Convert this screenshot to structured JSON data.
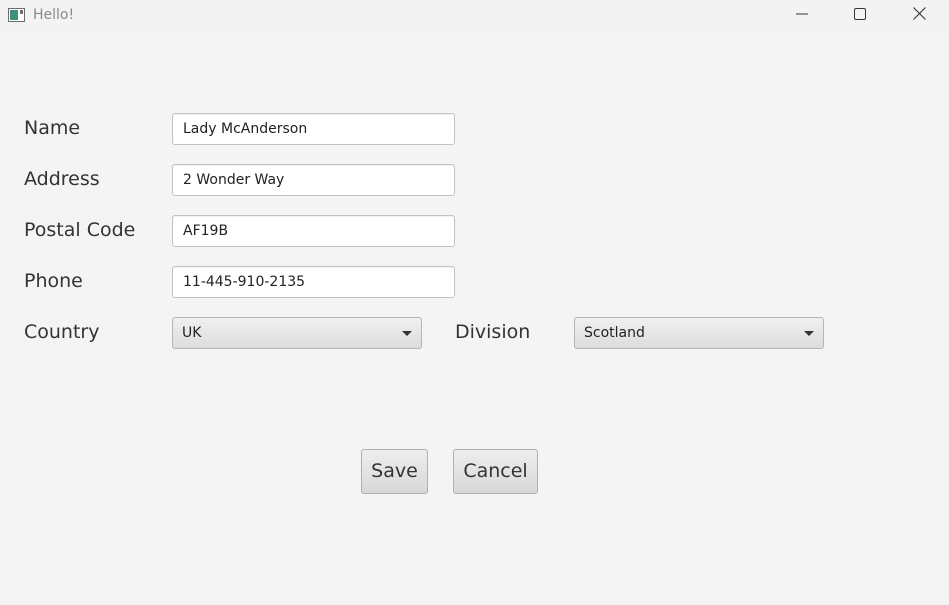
{
  "window": {
    "title": "Hello!",
    "icon": "app-window-icon",
    "controls": [
      "minimize-icon",
      "maximize-icon",
      "close-icon"
    ]
  },
  "form": {
    "name": {
      "label": "Name",
      "value": "Lady McAnderson"
    },
    "address": {
      "label": "Address",
      "value": "2 Wonder Way"
    },
    "postal_code": {
      "label": "Postal Code",
      "value": "AF19B"
    },
    "phone": {
      "label": "Phone",
      "value": "11-445-910-2135"
    },
    "country": {
      "label": "Country",
      "selected": "UK"
    },
    "division": {
      "label": "Division",
      "selected": "Scotland"
    }
  },
  "actions": {
    "save_label": "Save",
    "cancel_label": "Cancel"
  },
  "colors": {
    "background": "#f3f3f3",
    "field_background": "#ffffff",
    "field_border": "#c2c2c2",
    "text": "#333333",
    "title_text": "#8a8a8a"
  }
}
